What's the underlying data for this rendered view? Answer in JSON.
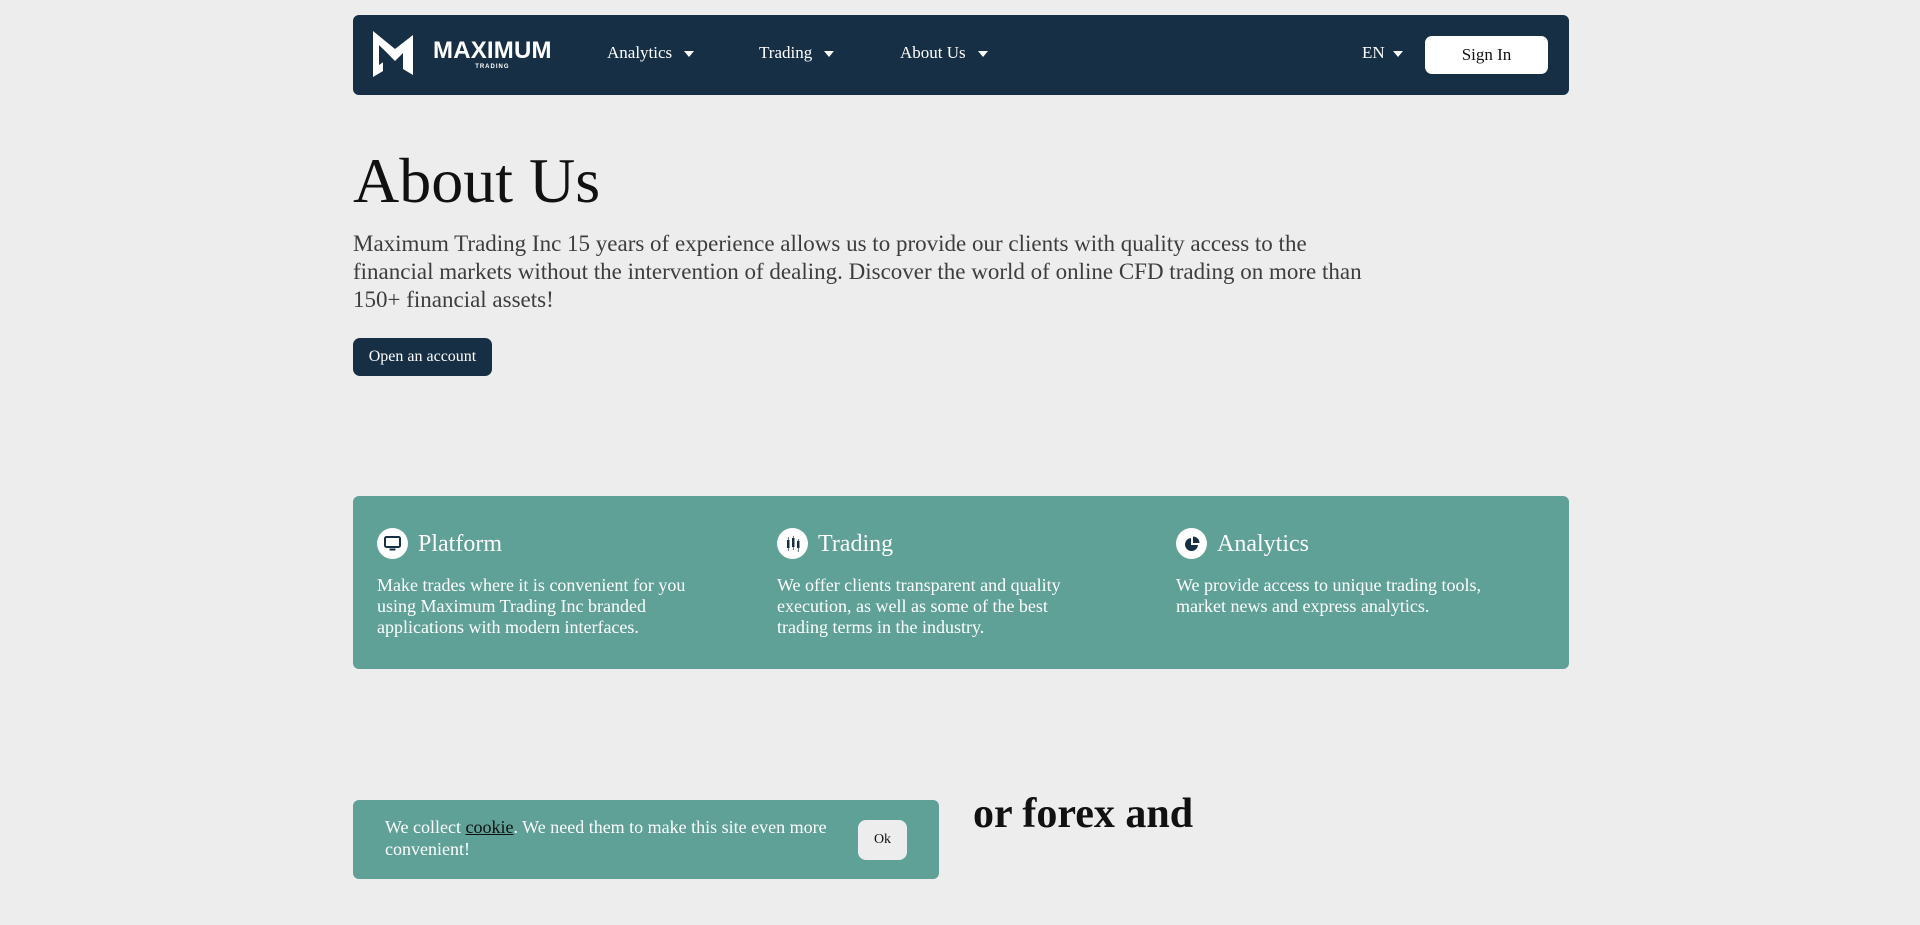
{
  "header": {
    "logo_text": "MAXIMUM",
    "logo_subtext": "TRADING",
    "nav": [
      {
        "label": "Analytics"
      },
      {
        "label": "Trading"
      },
      {
        "label": "About Us"
      }
    ],
    "language": "EN",
    "sign_in_label": "Sign In"
  },
  "hero": {
    "title": "About Us",
    "description": "Maximum Trading Inc 15 years of experience allows us to provide our clients with quality access to the financial markets without the intervention of dealing. Discover the world of online CFD trading on more than 150+ financial assets!",
    "cta_label": "Open an account"
  },
  "features": [
    {
      "title": "Platform",
      "text": "Make trades where it is convenient for you using Maximum Trading Inc branded applications with modern interfaces.",
      "icon": "monitor-icon"
    },
    {
      "title": "Trading",
      "text": "We offer clients transparent and quality execution, as well as some of the best trading terms in the industry.",
      "icon": "candlestick-icon"
    },
    {
      "title": "Analytics",
      "text": "We provide access to unique trading tools, market news and express analytics.",
      "icon": "pie-chart-icon"
    }
  ],
  "section2": {
    "heading_partial": "or forex and"
  },
  "cookie": {
    "text_before": "We collect ",
    "link": "cookie",
    "text_after": ". We need them to make this site even more convenient!",
    "ok_label": "Ok"
  },
  "colors": {
    "navy": "#172f44",
    "teal": "#5fa097",
    "background": "#ededed"
  }
}
